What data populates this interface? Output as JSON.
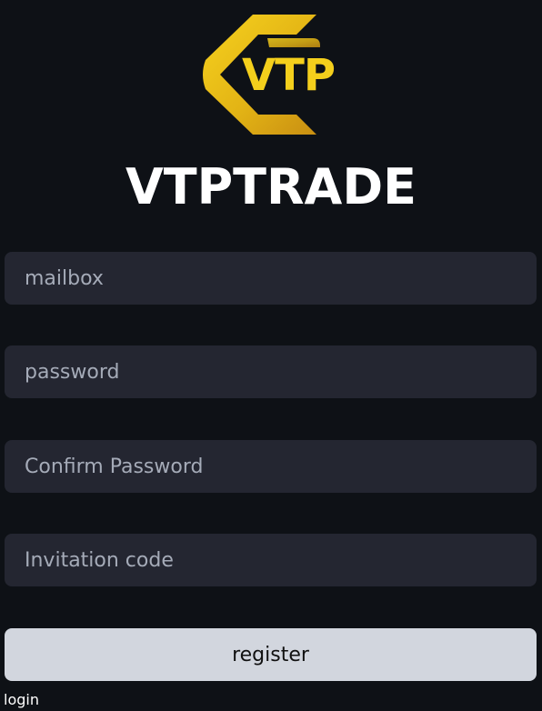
{
  "logo": {
    "text": "VTP",
    "icon": "vtp-logo-icon",
    "colors": {
      "gold_light": "#f4cf1c",
      "gold_dark": "#c98f12"
    }
  },
  "brand": {
    "title": "VTPTRADE"
  },
  "form": {
    "mailbox_placeholder": "mailbox",
    "password_placeholder": "password",
    "confirm_placeholder": "Confirm Password",
    "invitation_placeholder": "Invitation code",
    "register_label": "register"
  },
  "footer": {
    "login_label": "login"
  },
  "colors": {
    "background": "#0e1116",
    "input_bg": "#242631",
    "placeholder": "#a5abb8",
    "button_bg": "#d2d6de"
  }
}
